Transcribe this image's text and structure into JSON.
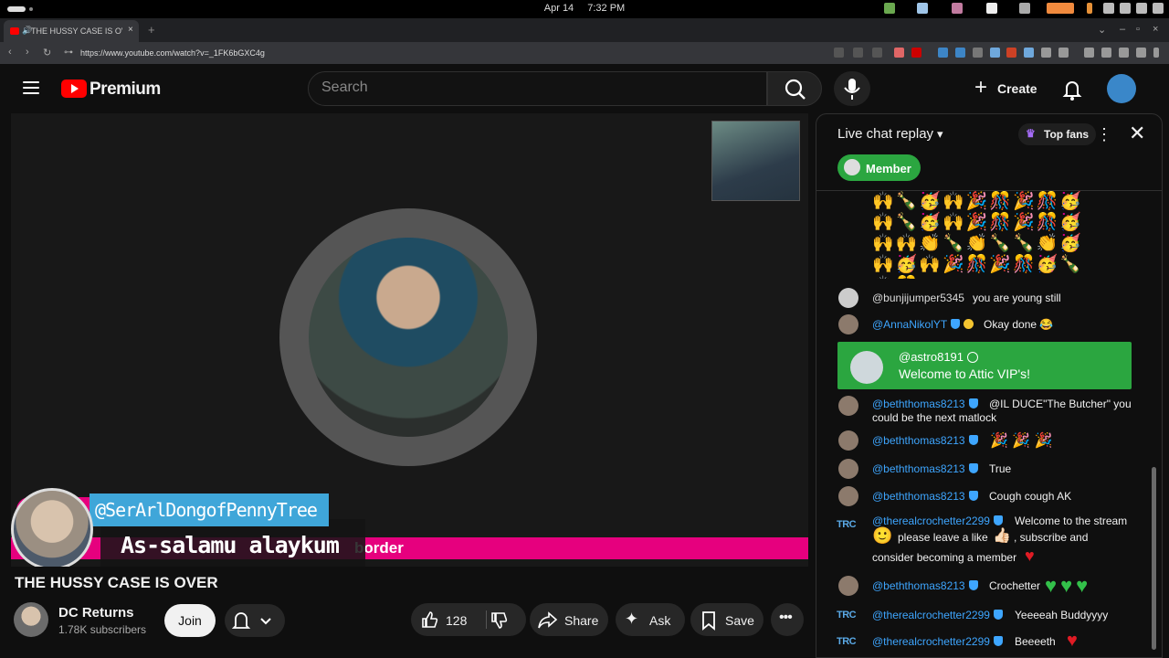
{
  "os": {
    "date": "Apr 14",
    "time": "7:32 PM"
  },
  "browser": {
    "tab_title": "THE HUSSY CASE IS OVER",
    "url": "https://www.youtube.com/watch?v=_1FK6bGXC4g",
    "tab_close": "×",
    "new_tab": "+"
  },
  "youtube": {
    "brand": "Premium",
    "search_placeholder": "Search",
    "create_label": "Create"
  },
  "video": {
    "overlay_username": "@SerArlDongofPennyTree",
    "overlay_message": "As-salamu alaykum",
    "ticker_text": "border",
    "title": "THE HUSSY CASE IS OVER",
    "channel_name": "DC Returns",
    "subscribers": "1.78K subscribers",
    "join_label": "Join",
    "likes": "128",
    "share_label": "Share",
    "ask_label": "Ask",
    "save_label": "Save"
  },
  "chat": {
    "title": "Live chat replay",
    "top_fans_label": "Top fans",
    "member_label": "Member",
    "emoji_rows": [
      "🙌🍾🥳🙌🎉🎊🎉🎊🥳",
      "🙌🍾🥳🙌🎉🎊🎉🎊🥳",
      "🙌🙌👏🍾👏🍾🍾👏🥳",
      "🙌🥳🙌🎉🎊🎉🎊🥳🍾",
      "🙌🎊"
    ],
    "messages": [
      {
        "user": "@bunjijumper5345",
        "text": "you are young still"
      },
      {
        "user": "@AnnaNikolYT",
        "text": "Okay done 😂"
      },
      {
        "user": "@beththomas8213",
        "text": "@IL DUCE\"The Butcher\" you could be the next matlock"
      },
      {
        "user": "@beththomas8213",
        "text": "🎉 🎉 🎉"
      },
      {
        "user": "@beththomas8213",
        "text": "True"
      },
      {
        "user": "@beththomas8213",
        "text": "Cough cough AK"
      },
      {
        "user": "@therealcrochetter2299",
        "text": "Welcome to the stream"
      },
      {
        "user": "@beththomas8213",
        "text": "Crochetter"
      },
      {
        "user": "@therealcrochetter2299",
        "text": "Yeeeeah Buddyyyy"
      },
      {
        "user": "@therealcrochetter2299",
        "text": "Beeeeth"
      }
    ],
    "welcome_line2": "please leave a like",
    "welcome_line2b": ", subscribe and",
    "welcome_line3": "consider becoming a member",
    "vip": {
      "user": "@astro8191",
      "text": "Welcome to Attic VIP's!"
    },
    "trc_badge": "TRC"
  }
}
